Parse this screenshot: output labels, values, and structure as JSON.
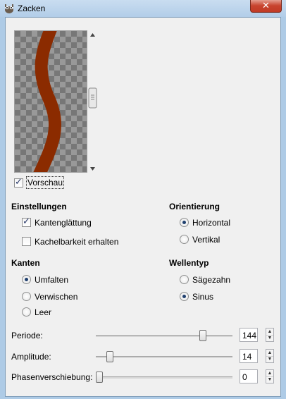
{
  "window": {
    "title": "Zacken",
    "close_glyph": "✕",
    "app_icon": "gimp-icon"
  },
  "preview": {
    "checkbox_label": "Vorschau",
    "checked": true,
    "wave_color": "#8b2b00",
    "checker_dark": "#777777",
    "checker_light": "#999999"
  },
  "einstellungen": {
    "heading": "Einstellungen",
    "antialias_label": "Kantenglättung",
    "antialias_checked": true,
    "tileable_label": "Kachelbarkeit erhalten",
    "tileable_checked": false
  },
  "orientierung": {
    "heading": "Orientierung",
    "options": [
      "Horizontal",
      "Vertikal"
    ],
    "selected": "Horizontal"
  },
  "kanten": {
    "heading": "Kanten",
    "options": [
      "Umfalten",
      "Verwischen",
      "Leer"
    ],
    "selected": "Umfalten"
  },
  "wellentyp": {
    "heading": "Wellentyp",
    "options": [
      "Sägezahn",
      "Sinus"
    ],
    "selected": "Sinus"
  },
  "sliders": [
    {
      "label": "Periode:",
      "value": "144",
      "fraction": 0.8
    },
    {
      "label": "Amplitude:",
      "value": "14",
      "fraction": 0.08
    },
    {
      "label": "Phasenverschiebung:",
      "value": "0",
      "fraction": 0.0
    }
  ],
  "colors": {
    "accent": "#1f3f6e",
    "title_bar": "#b2cde8",
    "close": "#c8442f"
  }
}
